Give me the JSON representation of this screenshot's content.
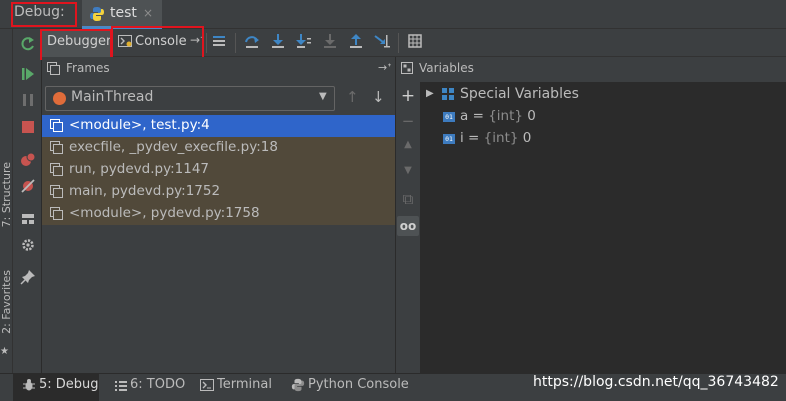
{
  "top_bar": {
    "debug_label": "Debug:",
    "tab_label": "test",
    "tab_close": "×"
  },
  "left_strip": {
    "structure": "7: Structure",
    "favorites": "2: Favorites",
    "favorites_star": "★"
  },
  "toolbar": {
    "debugger_tab": "Debugger",
    "console_tab": "Console",
    "pin_glyph": "→ᐩ"
  },
  "frames": {
    "title": "Frames",
    "pin_glyph": "→ᐩ",
    "thread": "MainThread",
    "caret": "▼",
    "up": "↑",
    "down": "↓",
    "rows": [
      {
        "text": "<module>, test.py:4",
        "selected": true
      },
      {
        "text": "execfile, _pydev_execfile.py:18",
        "selected": false
      },
      {
        "text": "run, pydevd.py:1147",
        "selected": false
      },
      {
        "text": "main, pydevd.py:1752",
        "selected": false
      },
      {
        "text": "<module>, pydevd.py:1758",
        "selected": false
      }
    ]
  },
  "variables": {
    "title": "Variables",
    "tools": [
      "+",
      "−",
      "▲",
      "▼",
      "⧉",
      "oo"
    ],
    "special": "Special Variables",
    "expand_arrow": "▶",
    "badge": "01",
    "items": [
      {
        "name": "a",
        "eq": " = ",
        "type": "{int}",
        "value": " 0"
      },
      {
        "name": "i",
        "eq": " = ",
        "type": "{int}",
        "value": " 0"
      }
    ]
  },
  "bottom_bar": {
    "debug": "5: Debug",
    "todo": "6: TODO",
    "terminal": "Terminal",
    "python_console": "Python Console"
  },
  "watermark": "https://blog.csdn.net/qq_36743482",
  "colors": {
    "accent": "#2f65ca",
    "annotation_box": "#e0141e",
    "frame_row_bg": "#51493a",
    "panel_bg": "#3c3f41",
    "tree_bg": "#2b2b2b"
  }
}
